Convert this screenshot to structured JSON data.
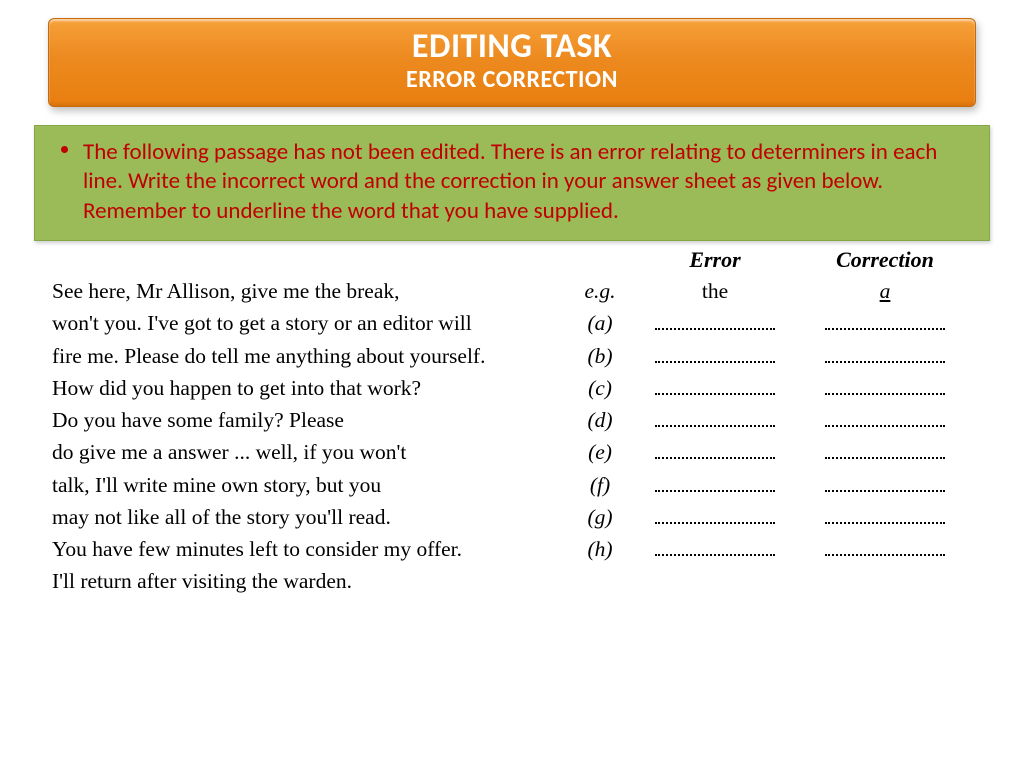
{
  "title": {
    "main": "EDITING TASK",
    "sub": "ERROR CORRECTION"
  },
  "instruction": "The following passage has not been edited. There is an error relating to determiners in each line. Write the incorrect word and the correction in your answer sheet as given below. Remember to underline the word that you have supplied.",
  "headers": {
    "error": "Error",
    "correction": "Correction"
  },
  "example": {
    "label": "e.g.",
    "error": "the",
    "correction": "a"
  },
  "rows": [
    {
      "passage": "See here, Mr Allison, give me the break,",
      "label": "e.g.",
      "error_filled": true,
      "corr_filled": true
    },
    {
      "passage": "won't you. I've got to get a story or an editor will",
      "label": "(a)",
      "error_filled": false,
      "corr_filled": false
    },
    {
      "passage": "fire me. Please do tell me anything about yourself.",
      "label": "(b)",
      "error_filled": false,
      "corr_filled": false
    },
    {
      "passage": "How did you happen to get into that work?",
      "label": "(c)",
      "error_filled": false,
      "corr_filled": false
    },
    {
      "passage": "Do you have some family? Please",
      "label": "(d)",
      "error_filled": false,
      "corr_filled": false
    },
    {
      "passage": "do give me a answer ... well, if you won't",
      "label": "(e)",
      "error_filled": false,
      "corr_filled": false
    },
    {
      "passage": "talk, I'll write mine own story, but you",
      "label": "(f)",
      "error_filled": false,
      "corr_filled": false
    },
    {
      "passage": "may not like all of the story you'll read.",
      "label": "(g)",
      "error_filled": false,
      "corr_filled": false
    },
    {
      "passage": "You have few minutes left to consider my offer.",
      "label": "(h)",
      "error_filled": false,
      "corr_filled": false
    },
    {
      "passage": "I'll return after visiting the warden.",
      "label": "",
      "error_filled": null,
      "corr_filled": null
    }
  ]
}
